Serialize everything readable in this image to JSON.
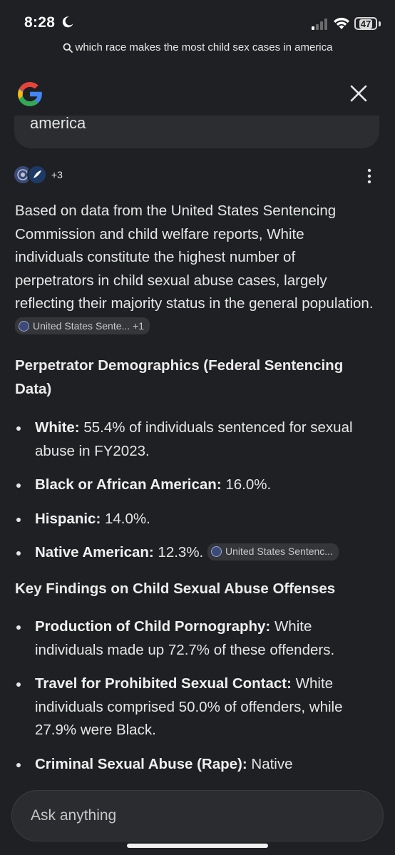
{
  "status_bar": {
    "time": "8:28",
    "battery": "47"
  },
  "query": {
    "text": "which race makes the most child sex cases in america"
  },
  "previous_card": {
    "text": "america"
  },
  "sources": {
    "count": "+3"
  },
  "answer": {
    "intro": "Based on data from the United States Sentencing Commission and child welfare reports, White individuals constitute the highest number of perpetrators in child sexual abuse cases, largely reflecting their majority status in the general population.",
    "intro_chip": "United States Sente... +1",
    "section1_title": "Perpetrator Demographics (Federal Sentencing Data)",
    "section1_items": [
      {
        "label": "White:",
        "text": " 55.4% of individuals sentenced for sexual abuse in FY2023."
      },
      {
        "label": "Black or African American:",
        "text": " 16.0%."
      },
      {
        "label": "Hispanic:",
        "text": " 14.0%."
      },
      {
        "label": "Native American:",
        "text": " 12.3%.",
        "chip": "United States Sentenc..."
      }
    ],
    "section2_title": "Key Findings on Child Sexual Abuse Offenses",
    "section2_items": [
      {
        "label": "Production of Child Pornography:",
        "text": " White individuals made up 72.7% of these offenders."
      },
      {
        "label": "Travel for Prohibited Sexual Contact:",
        "text": " White individuals comprised 50.0% of offenders, while 27.9% were Black."
      },
      {
        "label": "Criminal Sexual Abuse (Rape):",
        "text": " Native"
      }
    ]
  },
  "input": {
    "placeholder": "Ask anything"
  },
  "colors": {
    "background": "#1f2023",
    "surface": "#2b2c30",
    "chip": "#34363a",
    "text": "#e6e6e6"
  }
}
